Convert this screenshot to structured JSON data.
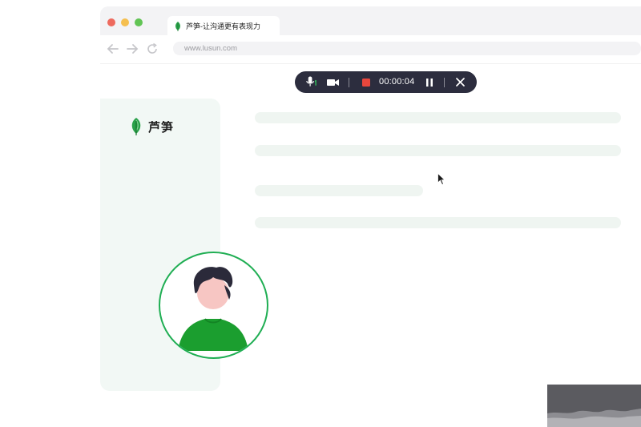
{
  "browser": {
    "traffic_lights": [
      "#ee6a5e",
      "#f5bf4f",
      "#61c454"
    ],
    "tab": {
      "title": "芦笋-让沟通更有表现力",
      "icon": "leaf-icon"
    },
    "nav": {
      "back_icon": "arrow-left-icon",
      "forward_icon": "arrow-right-icon",
      "reload_icon": "reload-icon"
    },
    "url": "www.lusun.com"
  },
  "recorder": {
    "mic_icon": "microphone-icon",
    "camera_icon": "camera-icon",
    "stop_icon": "stop-icon",
    "stop_color": "#e8473d",
    "timer": "00:00:04",
    "pause_icon": "pause-icon",
    "close_icon": "close-icon",
    "background": "#2c2d3e"
  },
  "page": {
    "logo_text": "芦笋",
    "logo_icon": "leaf-icon",
    "accent": "#1fae53",
    "sidebar_color": "#f2f8f5"
  }
}
